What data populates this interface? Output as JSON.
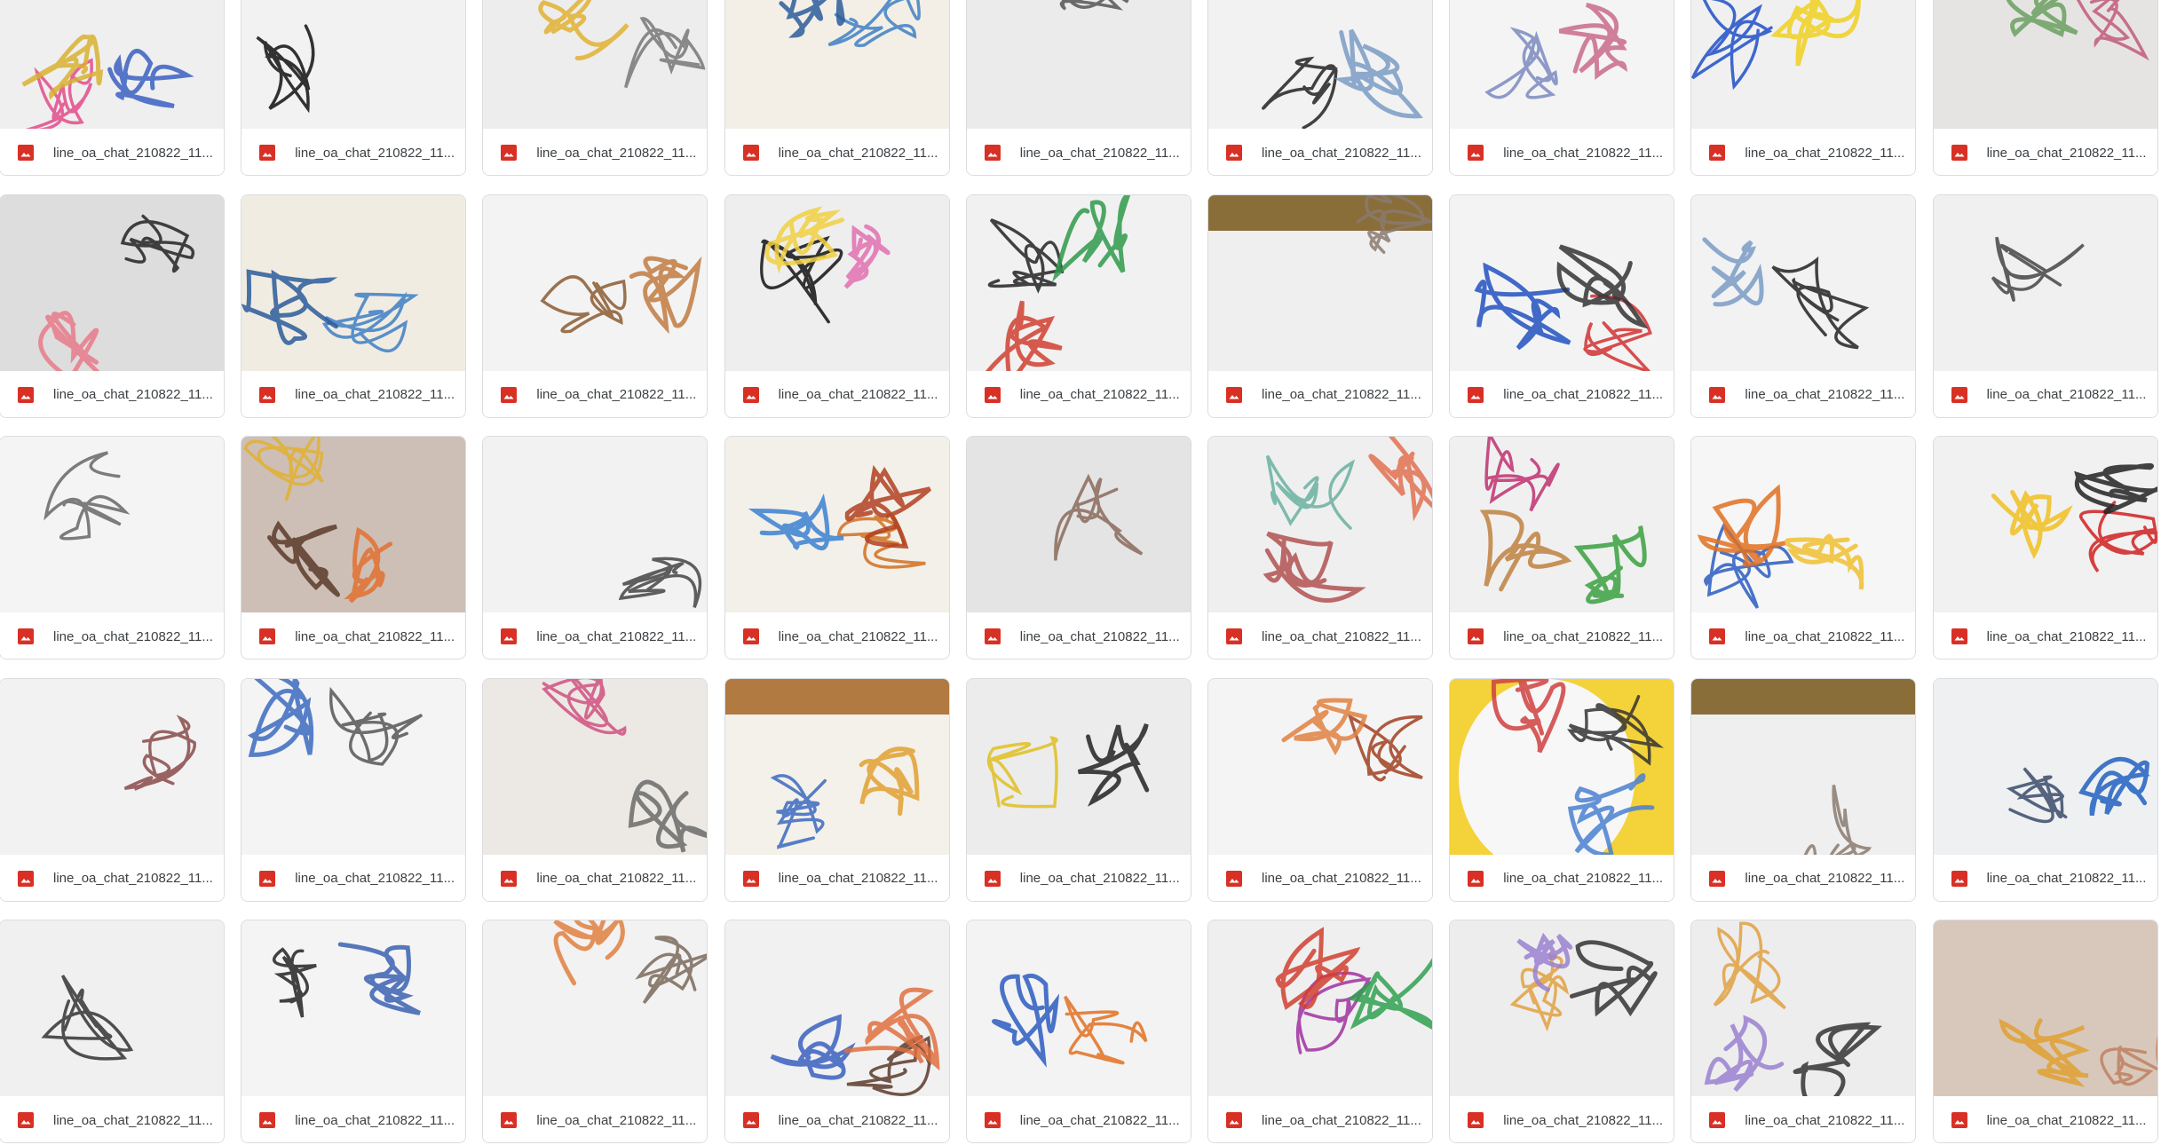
{
  "colors": {
    "image_icon": "#d93025",
    "tile_border": "#dadce0",
    "filename_text": "#3c4043"
  },
  "files": [
    {
      "name": "line_oa_chat_210822_11...",
      "thumb": {
        "bg": "#efefef",
        "c": [
          "#e24a8a",
          "#3a5fc2",
          "#d8b030"
        ]
      }
    },
    {
      "name": "line_oa_chat_210822_11...",
      "thumb": {
        "bg": "#f2f2f2",
        "c": [
          "#111111"
        ]
      }
    },
    {
      "name": "line_oa_chat_210822_11...",
      "thumb": {
        "bg": "#ededed",
        "c": [
          "#777777",
          "#e0b030"
        ]
      }
    },
    {
      "name": "line_oa_chat_210822_11...",
      "thumb": {
        "bg": "#f3efe6",
        "c": [
          "#3d7fc4",
          "#2a5c9a"
        ]
      }
    },
    {
      "name": "line_oa_chat_210822_11...",
      "thumb": {
        "bg": "#ebebeb",
        "c": [
          "#555555"
        ]
      }
    },
    {
      "name": "line_oa_chat_210822_11...",
      "thumb": {
        "bg": "#f2f2f2",
        "c": [
          "#222222",
          "#7a9cc6"
        ]
      }
    },
    {
      "name": "line_oa_chat_210822_11...",
      "thumb": {
        "bg": "#f4f4f4",
        "c": [
          "#7a8ac0",
          "#c86a8a"
        ]
      }
    },
    {
      "name": "line_oa_chat_210822_11...",
      "thumb": {
        "bg": "#f0f0f0",
        "c": [
          "#1f4fc8",
          "#f0d020"
        ]
      }
    },
    {
      "name": "line_oa_chat_210822_11...",
      "thumb": {
        "bg": "#e6e4e2",
        "c": [
          "#c05a7a",
          "#6aa060"
        ]
      }
    },
    {
      "name": "line_oa_chat_210822_11...",
      "thumb": {
        "bg": "#dddddd",
        "c": [
          "#222222",
          "#e87a8a"
        ]
      }
    },
    {
      "name": "line_oa_chat_210822_11...",
      "thumb": {
        "bg": "#f1ece2",
        "c": [
          "#3d7fc4",
          "#2a5c9a"
        ]
      }
    },
    {
      "name": "line_oa_chat_210822_11...",
      "thumb": {
        "bg": "#f3f3f3",
        "c": [
          "#8a5a30",
          "#c07a40"
        ]
      }
    },
    {
      "name": "line_oa_chat_210822_11...",
      "thumb": {
        "bg": "#eeeeee",
        "c": [
          "#111111",
          "#e070b0",
          "#f0d040"
        ]
      }
    },
    {
      "name": "line_oa_chat_210822_11...",
      "thumb": {
        "bg": "#f1f1f1",
        "c": [
          "#222222",
          "#2e9a4a",
          "#d04030"
        ]
      }
    },
    {
      "name": "line_oa_chat_210822_11...",
      "thumb": {
        "bg": "#efefef",
        "top": "#8a6e3a",
        "c": [
          "#8a7a70"
        ]
      }
    },
    {
      "name": "line_oa_chat_210822_11...",
      "thumb": {
        "bg": "#f3f3f3",
        "c": [
          "#d03030",
          "#2050c0",
          "#333333"
        ]
      }
    },
    {
      "name": "line_oa_chat_210822_11...",
      "thumb": {
        "bg": "#f2f2f2",
        "c": [
          "#222222",
          "#7a9cc6"
        ]
      }
    },
    {
      "name": "line_oa_chat_210822_11...",
      "thumb": {
        "bg": "#f0f0f0",
        "c": [
          "#444444"
        ]
      }
    },
    {
      "name": "line_oa_chat_210822_11...",
      "thumb": {
        "bg": "#f4f4f4",
        "c": [
          "#666666"
        ]
      }
    },
    {
      "name": "line_oa_chat_210822_11...",
      "thumb": {
        "bg": "#cdbfb6",
        "c": [
          "#e0b030",
          "#e07030",
          "#5a3a2a"
        ]
      }
    },
    {
      "name": "line_oa_chat_210822_11...",
      "thumb": {
        "bg": "#f2f2f2",
        "c": [
          "#444444"
        ]
      }
    },
    {
      "name": "line_oa_chat_210822_11...",
      "thumb": {
        "bg": "#f3f0ea",
        "c": [
          "#d07020",
          "#3a80d0",
          "#b04020"
        ]
      }
    },
    {
      "name": "line_oa_chat_210822_11...",
      "thumb": {
        "bg": "#e4e4e4",
        "c": [
          "#8a6a5a"
        ]
      }
    },
    {
      "name": "line_oa_chat_210822_11...",
      "thumb": {
        "bg": "#efefef",
        "c": [
          "#6ab0a0",
          "#e07050",
          "#b05050"
        ]
      }
    },
    {
      "name": "line_oa_chat_210822_11...",
      "thumb": {
        "bg": "#f0f0f0",
        "c": [
          "#c03070",
          "#3aa040",
          "#c08040"
        ]
      }
    },
    {
      "name": "line_oa_chat_210822_11...",
      "thumb": {
        "bg": "#f6f6f6",
        "c": [
          "#2a5cc0",
          "#f0c030",
          "#e07020"
        ]
      }
    },
    {
      "name": "line_oa_chat_210822_11...",
      "thumb": {
        "bg": "#f1f1f1",
        "c": [
          "#d02020",
          "#f0c020",
          "#222222"
        ]
      }
    },
    {
      "name": "line_oa_chat_210822_11...",
      "thumb": {
        "bg": "#f2f2f2",
        "c": [
          "#8a4a4a"
        ]
      }
    },
    {
      "name": "line_oa_chat_210822_11...",
      "thumb": {
        "bg": "#f4f4f4",
        "c": [
          "#555555",
          "#3a6ac0"
        ]
      }
    },
    {
      "name": "line_oa_chat_210822_11...",
      "thumb": {
        "bg": "#ece9e4",
        "c": [
          "#d05080",
          "#6a6a6a"
        ]
      }
    },
    {
      "name": "line_oa_chat_210822_11...",
      "thumb": {
        "bg": "#f4f1ea",
        "top": "#b07a40",
        "c": [
          "#3a6ac0",
          "#e0a030"
        ]
      }
    },
    {
      "name": "line_oa_chat_210822_11...",
      "thumb": {
        "bg": "#ececec",
        "c": [
          "#e0c020",
          "#222222"
        ]
      }
    },
    {
      "name": "line_oa_chat_210822_11...",
      "thumb": {
        "bg": "#f4f4f4",
        "c": [
          "#a04020",
          "#e08040"
        ]
      }
    },
    {
      "name": "line_oa_chat_210822_11...",
      "thumb": {
        "bg": "#f4d23a",
        "inner": "#f7f7f7",
        "c": [
          "#333333",
          "#d04040",
          "#4a80d0"
        ]
      }
    },
    {
      "name": "line_oa_chat_210822_11...",
      "thumb": {
        "bg": "#efefef",
        "top": "#8a6e3a",
        "c": [
          "#8a7a70"
        ]
      }
    },
    {
      "name": "line_oa_chat_210822_11...",
      "thumb": {
        "bg": "#eef0f2",
        "c": [
          "#3a4a6a",
          "#2060c0"
        ]
      }
    },
    {
      "name": "line_oa_chat_210822_11...",
      "thumb": {
        "bg": "#f0f0f0",
        "c": [
          "#333333"
        ]
      }
    },
    {
      "name": "line_oa_chat_210822_11...",
      "thumb": {
        "bg": "#f4f4f4",
        "c": [
          "#222222",
          "#3a60b0"
        ]
      }
    },
    {
      "name": "line_oa_chat_210822_11...",
      "thumb": {
        "bg": "#f2f2f2",
        "c": [
          "#7a6a5a",
          "#e08040"
        ]
      }
    },
    {
      "name": "line_oa_chat_210822_11...",
      "thumb": {
        "bg": "#f1f1f1",
        "c": [
          "#5a3a2a",
          "#3a60c0",
          "#e07040"
        ]
      }
    },
    {
      "name": "line_oa_chat_210822_11...",
      "thumb": {
        "bg": "#f3f3f3",
        "c": [
          "#e07020",
          "#2a5ac0"
        ]
      }
    },
    {
      "name": "line_oa_chat_210822_11...",
      "thumb": {
        "bg": "#efefef",
        "c": [
          "#a030a0",
          "#30a050",
          "#d04030"
        ]
      }
    },
    {
      "name": "line_oa_chat_210822_11...",
      "thumb": {
        "bg": "#ededed",
        "c": [
          "#e0a040",
          "#333333",
          "#9a80d0"
        ]
      }
    },
    {
      "name": "line_oa_chat_210822_11...",
      "thumb": {
        "bg": "#ededed",
        "c": [
          "#e0a040",
          "#333333",
          "#9a80d0"
        ]
      }
    },
    {
      "name": "line_oa_chat_210822_11...",
      "thumb": {
        "bg": "#d8c8bc",
        "c": [
          "#c08060",
          "#e0a030"
        ]
      }
    }
  ]
}
